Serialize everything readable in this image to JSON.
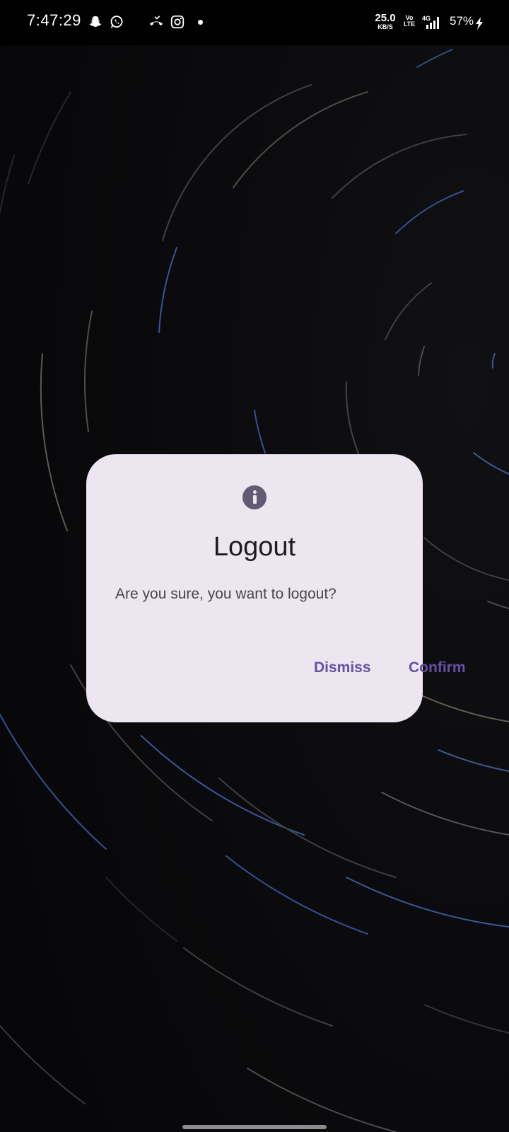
{
  "status_bar": {
    "time": "7:47:29",
    "net_speed_value": "25.0",
    "net_speed_unit": "KB/S",
    "volte_line1": "Vo",
    "volte_line2": "LTE",
    "battery": "57%",
    "icons": [
      "snapchat-icon",
      "whatsapp-icon",
      "missed-call-icon",
      "instagram-icon",
      "notification-dot",
      "volte-icon",
      "signal-4g-icon",
      "charging-icon"
    ]
  },
  "dialog": {
    "icon": "info-icon",
    "title": "Logout",
    "message": "Are you sure, you want to logout?",
    "dismiss_label": "Dismiss",
    "confirm_label": "Confirm",
    "accent_color": "#6750a4",
    "surface_color": "#ece6f0"
  }
}
